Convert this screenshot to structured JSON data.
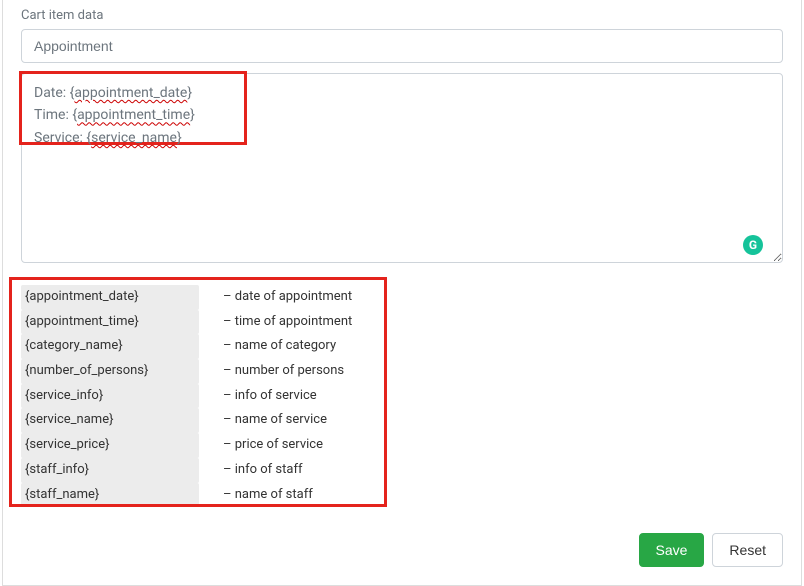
{
  "section_label": "Cart item data",
  "title_input_value": "Appointment",
  "template_text": "Date: {appointment_date}\nTime: {appointment_time}\nService: {service_name}",
  "variables": [
    {
      "token": "{appointment_date}",
      "desc": "– date of appointment"
    },
    {
      "token": "{appointment_time}",
      "desc": "– time of appointment"
    },
    {
      "token": "{category_name}",
      "desc": "– name of category"
    },
    {
      "token": "{number_of_persons}",
      "desc": "– number of persons"
    },
    {
      "token": "{service_info}",
      "desc": "– info of service"
    },
    {
      "token": "{service_name}",
      "desc": "– name of service"
    },
    {
      "token": "{service_price}",
      "desc": "– price of service"
    },
    {
      "token": "{staff_info}",
      "desc": "– info of staff"
    },
    {
      "token": "{staff_name}",
      "desc": "– name of staff"
    }
  ],
  "buttons": {
    "save": "Save",
    "reset": "Reset"
  }
}
